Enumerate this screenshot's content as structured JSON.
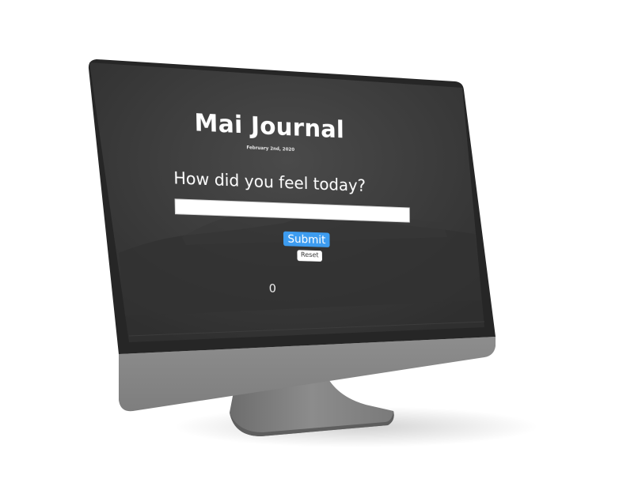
{
  "app": {
    "title": "Mai Journal",
    "date": "February 2nd, 2020"
  },
  "form": {
    "prompt": "How did you feel today?",
    "input_value": "",
    "input_placeholder": "",
    "submit_label": "Submit",
    "reset_label": "Reset"
  },
  "entries": {
    "count": "0"
  },
  "colors": {
    "screen_bg": "#3b3b3b",
    "submit_accent": "#3d9cf0",
    "device_body": "#8a8a8a",
    "bezel": "#2a2a2a"
  }
}
